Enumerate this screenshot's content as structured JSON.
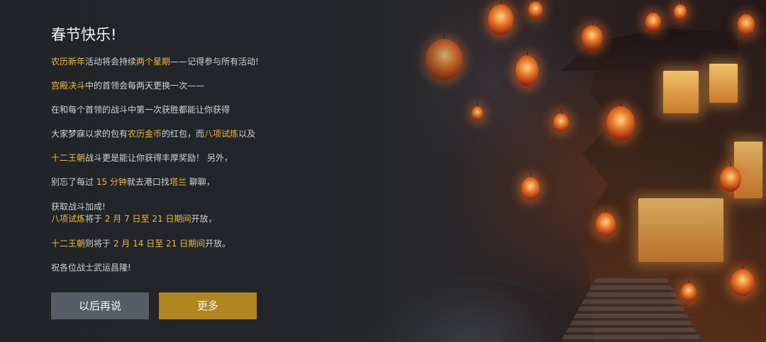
{
  "dialog": {
    "title": "春节快乐!",
    "line1": {
      "a": "农历新年",
      "b": "活动将会持续",
      "c": "两个星期",
      "d": "——记得参与所有活动!"
    },
    "line2": {
      "a": "宫殿决斗",
      "b": "中的首领会每两天更换一次——"
    },
    "line3": {
      "a": "在和每个首领的战斗中第一次获胜都能让你获得"
    },
    "line4": {
      "a": "大家梦寐以求的包有",
      "b": "农历金币",
      "c": "的红包，而",
      "d": "八项试炼",
      "e": "以及"
    },
    "line5": {
      "a": "十二王朝",
      "b": "战斗更是能让你获得丰厚奖励！ 另外，"
    },
    "line6": {
      "a": "别忘了每过 ",
      "b": "15 分钟",
      "c": "就去港口找",
      "d": "塔兰",
      "e": " 聊聊，"
    },
    "line7": {
      "a": "获取战斗加成!"
    },
    "line8": {
      "a": "八项试炼",
      "b": "将于 ",
      "c": "2 月 7 日至 21 日期间",
      "d": "开放，"
    },
    "line9": {
      "a": "十二王朝",
      "b": "则将于 ",
      "c": "2 月 14 日至 21 日期间",
      "d": "开放。"
    },
    "line10": {
      "a": "祝各位战士武运昌隆!"
    }
  },
  "buttons": {
    "later_label": "以后再说",
    "more_label": "更多"
  },
  "colors": {
    "highlight": "#f0b93a",
    "body_text": "#d3d3d3",
    "secondary_button": "#575d66",
    "primary_button": "#b08620"
  }
}
